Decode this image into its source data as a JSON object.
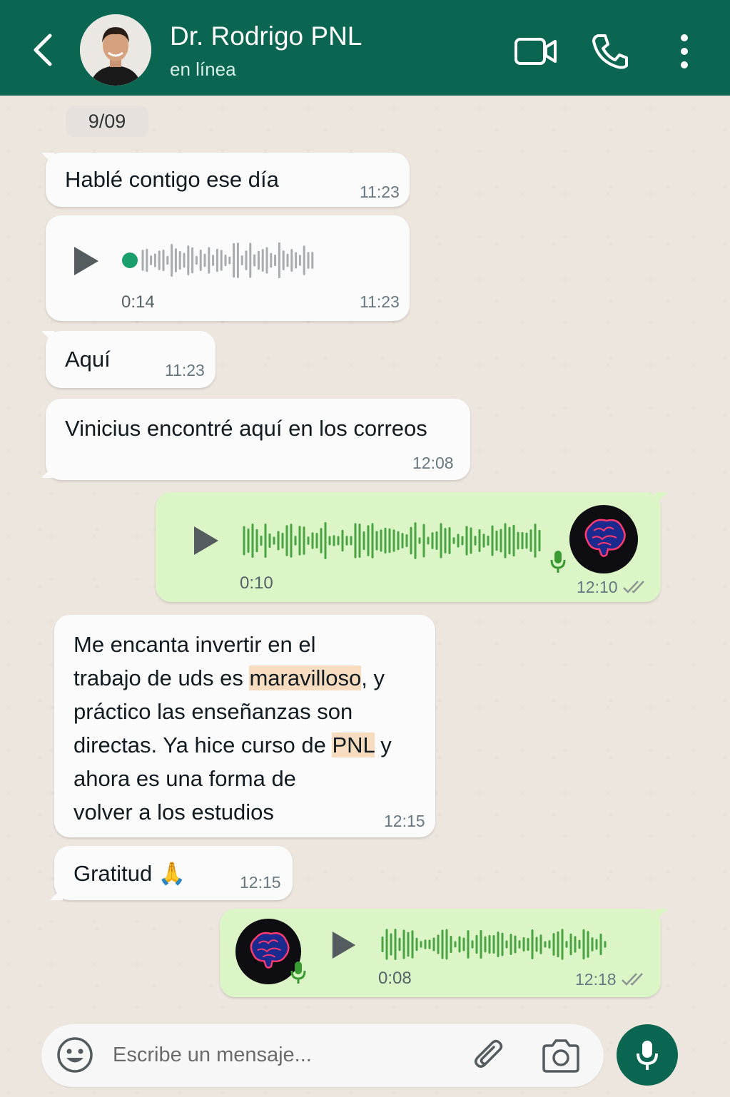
{
  "header": {
    "contact_name": "Dr. Rodrigo PNL",
    "status": "en línea",
    "icons": [
      "back-arrow-icon",
      "video-call-icon",
      "phone-icon",
      "more-options-icon"
    ]
  },
  "date_chip": "9/09",
  "messages": [
    {
      "direction": "in",
      "type": "text",
      "text": "Hablé contigo ese día",
      "time": "11:23"
    },
    {
      "direction": "in",
      "type": "audio",
      "duration": "0:14",
      "time": "11:23"
    },
    {
      "direction": "in",
      "type": "text",
      "text": "Aquí",
      "time": "11:23"
    },
    {
      "direction": "in",
      "type": "text",
      "text": "Vinicius encontré aquí en los correos",
      "time": "12:08"
    },
    {
      "direction": "out",
      "type": "audio",
      "duration": "0:10",
      "time": "12:10"
    },
    {
      "direction": "in",
      "type": "text",
      "lines": [
        "Me encanta invertir en el",
        "trabajo de uds es ",
        "maravilloso",
        ", y",
        "práctico las enseñanzas son",
        "directas. Ya hice curso de ",
        "PNL",
        " y",
        "ahora es una forma de",
        "volver a los estudios"
      ],
      "time": "12:15"
    },
    {
      "direction": "in",
      "type": "text",
      "text": "Gratitud 🙏",
      "time": "12:15"
    },
    {
      "direction": "out",
      "type": "audio",
      "duration": "0:08",
      "time": "12:18"
    }
  ],
  "composer": {
    "placeholder": "Escribe un mensaje...",
    "icons": [
      "emoji-icon",
      "attach-icon",
      "camera-icon",
      "mic-icon"
    ]
  },
  "colors": {
    "header": "#0b6651",
    "outgoing_bubble": "#dcf5c7",
    "incoming_bubble": "#fbfbfb",
    "wave_green": "#3a9b32",
    "highlight": "#f8dcc0"
  }
}
